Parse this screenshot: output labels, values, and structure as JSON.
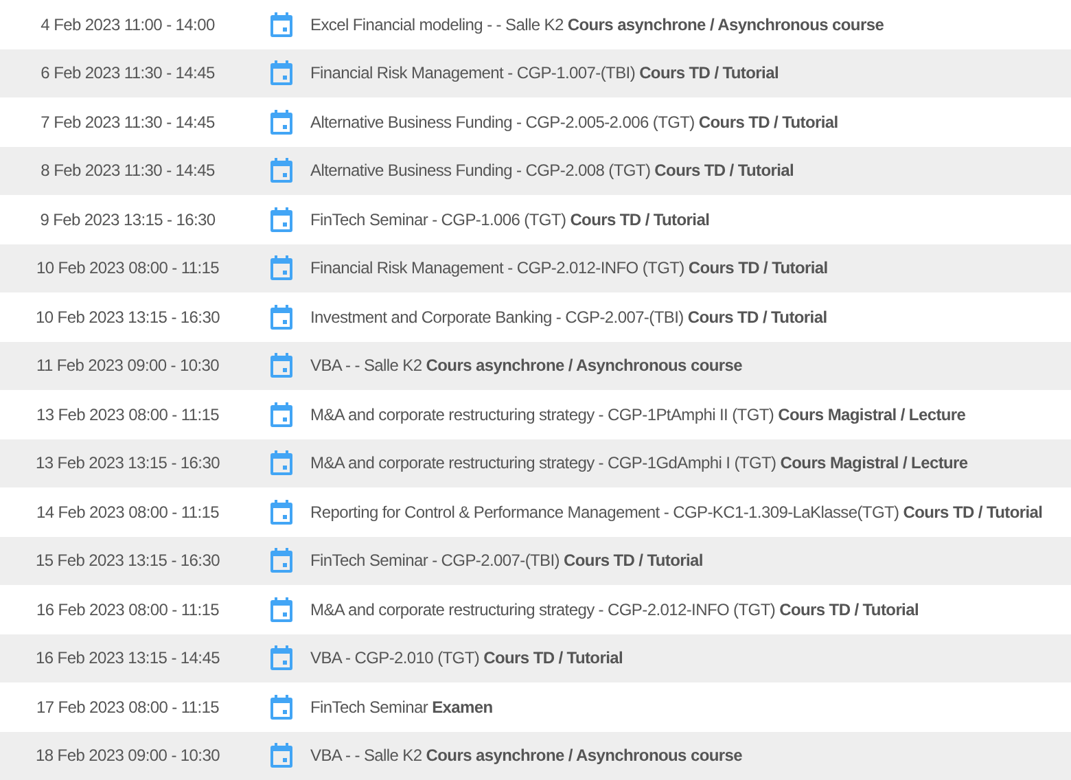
{
  "events": [
    {
      "when": "4 Feb 2023 11:00 - 14:00",
      "title": "Excel Financial modeling - - Salle K2 **Cours asynchrone / Asynchronous course**"
    },
    {
      "when": "6 Feb 2023 11:30 - 14:45",
      "title": "Financial Risk Management - CGP-1.007-(TBI) **Cours TD / Tutorial**"
    },
    {
      "when": "7 Feb 2023 11:30 - 14:45",
      "title": "Alternative Business Funding - CGP-2.005-2.006 (TGT) **Cours TD / Tutorial**"
    },
    {
      "when": "8 Feb 2023 11:30 - 14:45",
      "title": "Alternative Business Funding - CGP-2.008 (TGT) **Cours TD / Tutorial**"
    },
    {
      "when": "9 Feb 2023 13:15 - 16:30",
      "title": "FinTech Seminar - CGP-1.006 (TGT) **Cours TD / Tutorial**"
    },
    {
      "when": "10 Feb 2023 08:00 - 11:15",
      "title": "Financial Risk Management - CGP-2.012-INFO (TGT) **Cours TD / Tutorial**"
    },
    {
      "when": "10 Feb 2023 13:15 - 16:30",
      "title": "Investment and Corporate Banking - CGP-2.007-(TBI) **Cours TD / Tutorial**"
    },
    {
      "when": "11 Feb 2023 09:00 - 10:30",
      "title": "VBA - - Salle K2 **Cours asynchrone / Asynchronous course**"
    },
    {
      "when": "13 Feb 2023 08:00 - 11:15",
      "title": "M&A and corporate restructuring strategy - CGP-1PtAmphi II (TGT) **Cours Magistral / Lecture**"
    },
    {
      "when": "13 Feb 2023 13:15 - 16:30",
      "title": "M&A and corporate restructuring strategy - CGP-1GdAmphi I (TGT) **Cours Magistral / Lecture**"
    },
    {
      "when": "14 Feb 2023 08:00 - 11:15",
      "title": "Reporting for Control & Performance Management - CGP-KC1-1.309-LaKlasse(TGT) **Cours TD / Tutorial**"
    },
    {
      "when": "15 Feb 2023 13:15 - 16:30",
      "title": "FinTech Seminar - CGP-2.007-(TBI) **Cours TD / Tutorial**"
    },
    {
      "when": "16 Feb 2023 08:00 - 11:15",
      "title": "M&A and corporate restructuring strategy - CGP-2.012-INFO (TGT) **Cours TD / Tutorial**"
    },
    {
      "when": "16 Feb 2023 13:15 - 14:45",
      "title": "VBA - CGP-2.010 (TGT) **Cours TD / Tutorial**"
    },
    {
      "when": "17 Feb 2023 08:00 - 11:15",
      "title": "FinTech Seminar **Examen**"
    },
    {
      "when": "18 Feb 2023 09:00 - 10:30",
      "title": "VBA - - Salle K2 **Cours asynchrone / Asynchronous course**"
    }
  ]
}
